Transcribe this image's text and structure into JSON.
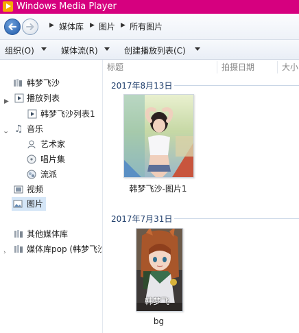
{
  "window": {
    "title": "Windows Media Player"
  },
  "breadcrumb": [
    "媒体库",
    "图片",
    "所有图片"
  ],
  "toolbar": {
    "organize": "组织(O)",
    "stream": "媒体流(R)",
    "create_playlist": "创建播放列表(C)"
  },
  "sidebar": {
    "user": "韩梦飞沙",
    "playlists": "播放列表",
    "playlist_item": "韩梦飞沙列表1",
    "music": "音乐",
    "artist": "艺术家",
    "album": "唱片集",
    "genre": "流派",
    "video": "视频",
    "pictures": "图片",
    "other_libraries": "其他媒体库",
    "remote_library": "媒体库pop (韩梦飞沙"
  },
  "columns": {
    "title": "标题",
    "date_taken": "拍摄日期",
    "size": "大小"
  },
  "groups": [
    {
      "date": "2017年8月13日",
      "caption": "韩梦飞沙-图片1"
    },
    {
      "date": "2017年7月31日",
      "caption": "bg",
      "overlay": "韩梦飞"
    }
  ],
  "colors": {
    "titlebar": "#d6007f",
    "selection": "#d5e6f7"
  }
}
